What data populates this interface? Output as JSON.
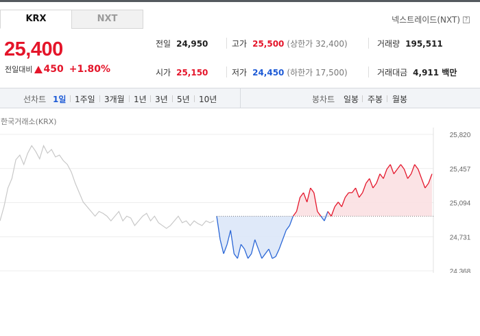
{
  "tabs": [
    {
      "label": "KRX",
      "active": true
    },
    {
      "label": "NXT",
      "active": false
    }
  ],
  "nxt_link": {
    "label": "넥스트레이드(NXT)",
    "help_icon": "?"
  },
  "quote": {
    "price": "25,400",
    "change_label": "전일대비",
    "change_value": "450",
    "change_pct": "+1.80%",
    "direction_icon": "up-triangle",
    "color_up": "#e4152a",
    "color_down": "#1e5bd6"
  },
  "stats": {
    "prev_label": "전일",
    "prev_value": "24,950",
    "high_label": "고가",
    "high_value": "25,500",
    "upper_limit_text": "(상한가 32,400)",
    "volume_label": "거래량",
    "volume_value": "195,511",
    "open_label": "시가",
    "open_value": "25,150",
    "low_label": "저가",
    "low_value": "24,450",
    "lower_limit_text": "(하한가 17,500)",
    "amount_label": "거래대금",
    "amount_value": "4,911 백만"
  },
  "toolbar": {
    "line_chart_label": "선차트",
    "periods": [
      "1일",
      "1주일",
      "3개월",
      "1년",
      "3년",
      "5년",
      "10년"
    ],
    "selected_period": "1일",
    "candle_chart_label": "봉차트",
    "candle_periods": [
      "일봉",
      "주봉",
      "월봉"
    ]
  },
  "chart_title": "한국거래소(KRX)",
  "chart_data": {
    "type": "line",
    "title": "한국거래소(KRX)",
    "y_ticks": [
      "25,820",
      "25,457",
      "25,094",
      "24,731",
      "24,368"
    ],
    "ylim": [
      24368,
      25820
    ],
    "reference_value": 24950,
    "segments": [
      {
        "name": "previous",
        "color": "#c8c8c8",
        "values": [
          24900,
          25050,
          25250,
          25350,
          25550,
          25600,
          25500,
          25620,
          25700,
          25640,
          25560,
          25700,
          25620,
          25660,
          25580,
          25600,
          25540,
          25500,
          25420,
          25300,
          25200,
          25100,
          25050,
          25000,
          24950,
          25000,
          24980,
          24950,
          24900,
          24950,
          25000,
          24900,
          24950,
          24930,
          24850,
          24900,
          24950,
          24980,
          24900,
          24950,
          24880,
          24850,
          24820,
          24850,
          24900,
          24950,
          24880,
          24900,
          24850,
          24900,
          24870,
          24850,
          24900,
          24880,
          24900
        ]
      },
      {
        "name": "today",
        "color_down": "#2a66d6",
        "color_up": "#e4152a",
        "values": [
          24950,
          24700,
          24550,
          24650,
          24800,
          24550,
          24500,
          24650,
          24600,
          24500,
          24550,
          24700,
          24600,
          24500,
          24550,
          24600,
          24500,
          24520,
          24600,
          24700,
          24800,
          24850,
          24950,
          25000,
          25150,
          25200,
          25100,
          25250,
          25200,
          25000,
          24950,
          24900,
          25000,
          24950,
          25050,
          25100,
          25050,
          25150,
          25200,
          25200,
          25250,
          25150,
          25200,
          25300,
          25350,
          25250,
          25300,
          25400,
          25350,
          25450,
          25500,
          25400,
          25450,
          25500,
          25450,
          25350,
          25400,
          25500,
          25450,
          25350,
          25250,
          25300,
          25400
        ]
      }
    ]
  }
}
